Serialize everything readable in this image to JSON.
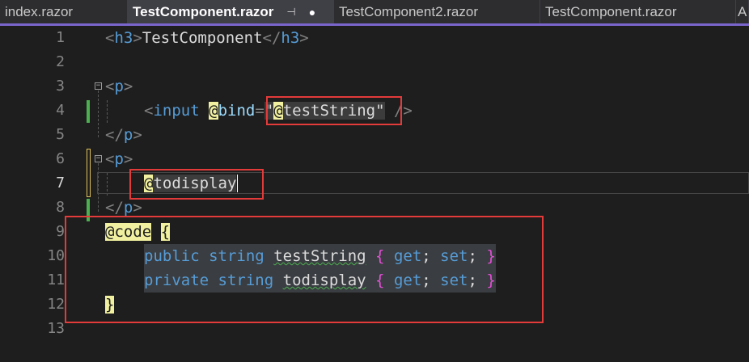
{
  "tabs": [
    {
      "label": "index.razor"
    },
    {
      "label": "TestComponent.razor",
      "pin": "⊣",
      "dirty": "●"
    },
    {
      "label": "TestComponent2.razor"
    },
    {
      "label": "TestComponent.razor"
    },
    {
      "label": "A"
    }
  ],
  "lines": [
    {
      "n": "1"
    },
    {
      "n": "2"
    },
    {
      "n": "3"
    },
    {
      "n": "4"
    },
    {
      "n": "5"
    },
    {
      "n": "6"
    },
    {
      "n": "7"
    },
    {
      "n": "8"
    },
    {
      "n": "9"
    },
    {
      "n": "10"
    },
    {
      "n": "11"
    },
    {
      "n": "12"
    },
    {
      "n": "13"
    }
  ],
  "code": {
    "l1": {
      "open": "<",
      "h3": "h3",
      "close": ">",
      "text": "TestComponent",
      "open2": "</",
      "h3b": "h3",
      "close2": ">"
    },
    "l3": {
      "open": "<",
      "p": "p",
      "close": ">"
    },
    "l4": {
      "open": "<",
      "input": "input",
      "at": "@",
      "bind": "bind",
      "eq": "=",
      "q1": "\"",
      "at2": "@",
      "var": "testString",
      "q2": "\"",
      "end": " />"
    },
    "l5": {
      "open": "</",
      "p": "p",
      "close": ">"
    },
    "l6": {
      "open": "<",
      "p": "p",
      "close": ">"
    },
    "l7": {
      "at": "@",
      "var": "todisplay"
    },
    "l8": {
      "open": "</",
      "p": "p",
      "close": ">"
    },
    "l9": {
      "at": "@",
      "kw": "code",
      "brace": "{"
    },
    "l10": {
      "mod": "public",
      "type": "string",
      "name": "testString",
      "ob": "{",
      "get": "get",
      "semi1": ";",
      "set": "set",
      "semi2": ";",
      "cb": "}"
    },
    "l11": {
      "mod": "private",
      "type": "string",
      "name": "todisplay",
      "ob": "{",
      "get": "get",
      "semi1": ";",
      "set": "set",
      "semi2": ";",
      "cb": "}"
    },
    "l12": {
      "brace": "}"
    }
  },
  "colors": {
    "accent": "#7a65cc",
    "annotation": "#e33a3a",
    "change-saved": "#4caf50",
    "change-unsaved": "#e2c35a"
  }
}
